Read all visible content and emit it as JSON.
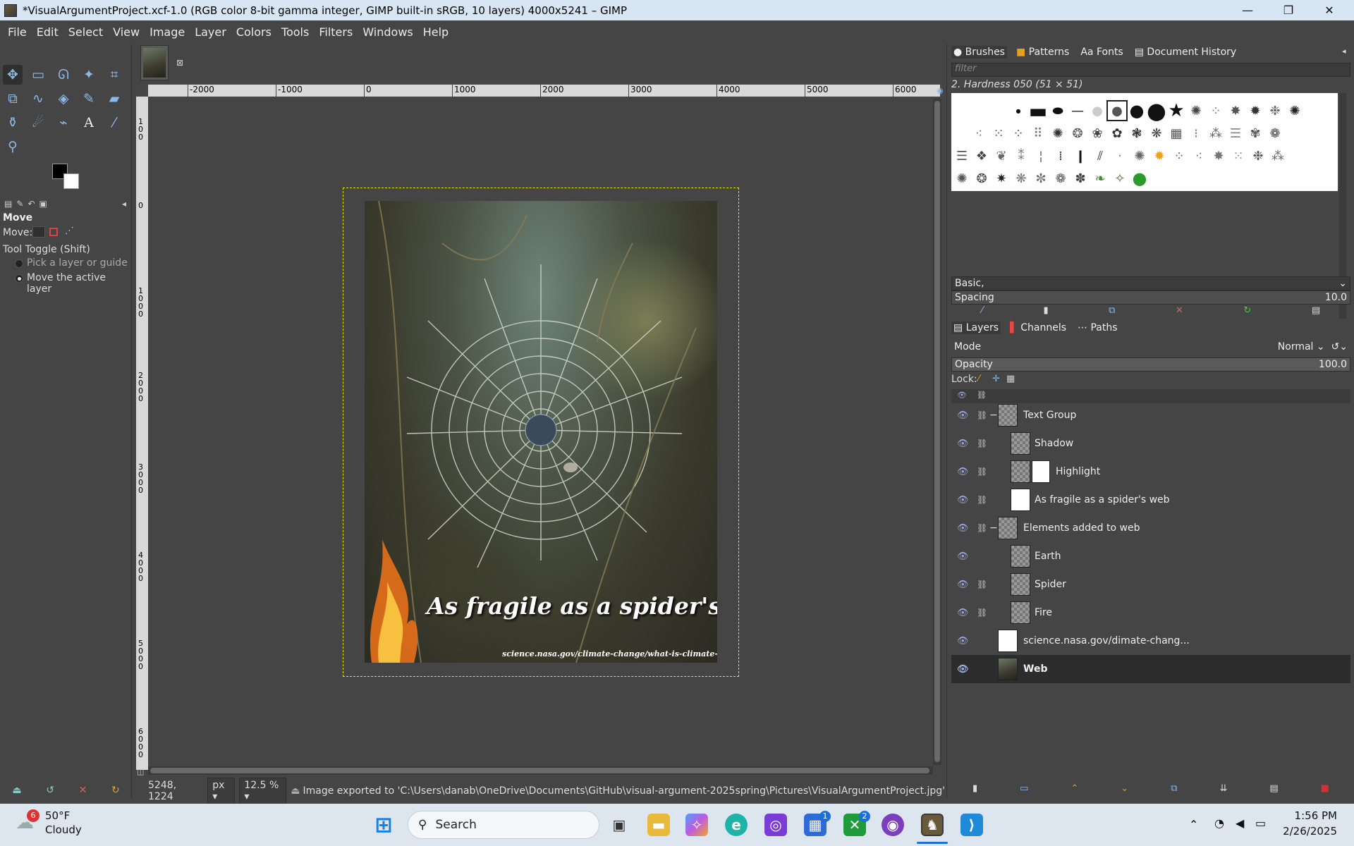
{
  "window": {
    "title": "*VisualArgumentProject.xcf-1.0 (RGB color 8-bit gamma integer, GIMP built-in sRGB, 10 layers) 4000x5241 – GIMP",
    "minimize": "—",
    "maximize": "❐",
    "close": "✕"
  },
  "menu": [
    "File",
    "Edit",
    "Select",
    "View",
    "Image",
    "Layer",
    "Colors",
    "Tools",
    "Filters",
    "Windows",
    "Help"
  ],
  "tool_options": {
    "title": "Move",
    "move_label": "Move:",
    "toggle_label": "Tool Toggle  (Shift)",
    "option1": "Pick a layer or guide",
    "option2": "Move the active layer"
  },
  "ruler": {
    "top_ticks": [
      "-2000",
      "-1000",
      "0",
      "1000",
      "2000",
      "3000",
      "4000",
      "5000",
      "6000"
    ],
    "left_ticks": [
      "1\n0\n0",
      "0",
      "1\n0\n0\n0",
      "2\n0\n0\n0",
      "3\n0\n0\n0",
      "4\n0\n0\n0",
      "5\n0\n0\n0",
      "6\n0\n0\n0"
    ]
  },
  "artwork": {
    "title": "As fragile as a spider's web",
    "url": "science.nasa.gov/climate-change/what-is-climate-change"
  },
  "status": {
    "coords": "5248, 1224",
    "unit": "px",
    "zoom": "12.5 %",
    "message": "Image exported to 'C:\\Users\\danab\\OneDrive\\Documents\\GitHub\\visual-argument-2025spring\\Pictures\\VisualArgumentProject.jpg'"
  },
  "brushes_panel": {
    "tabs": [
      "Brushes",
      "Patterns",
      "Fonts",
      "Document History"
    ],
    "filter_placeholder": "filter",
    "selected_brush": "2. Hardness 050 (51 × 51)",
    "preset": "Basic,",
    "spacing_label": "Spacing",
    "spacing_value": "10.0"
  },
  "layers_panel": {
    "tabs": [
      "Layers",
      "Channels",
      "Paths"
    ],
    "mode_label": "Mode",
    "mode_value": "Normal",
    "opacity_label": "Opacity",
    "opacity_value": "100.0",
    "lock_label": "Lock:",
    "layers": [
      {
        "name": "Text Group"
      },
      {
        "name": "Shadow"
      },
      {
        "name": "Highlight"
      },
      {
        "name": "As fragile as a spider's web"
      },
      {
        "name": "Elements added to web"
      },
      {
        "name": "Earth"
      },
      {
        "name": "Spider"
      },
      {
        "name": "Fire"
      },
      {
        "name": "science.nasa.gov/dimate-chang..."
      },
      {
        "name": "Web"
      }
    ]
  },
  "taskbar": {
    "weather_temp": "50°F",
    "weather_desc": "Cloudy",
    "weather_badge": "6",
    "search_label": "Search",
    "time": "1:56 PM",
    "date": "2/26/2025",
    "store_badge": "1",
    "xbox_badge": "2"
  },
  "colors": {
    "accent": "#8fb8e8",
    "selection_border": "#e6e600",
    "titlebar": "#d7e6f2",
    "taskbar": "#dde5ee"
  }
}
